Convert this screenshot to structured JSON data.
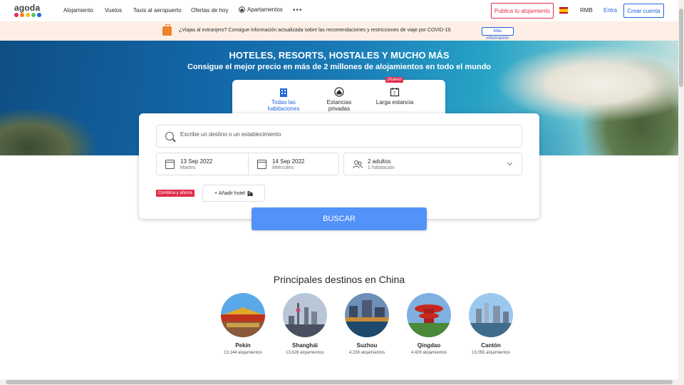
{
  "header": {
    "logo": "agoda",
    "logo_colors": [
      "#e12d4a",
      "#f08228",
      "#f5c11c",
      "#59c36a",
      "#2067da"
    ],
    "nav": [
      "Alojamiento",
      "Vuelos",
      "Taxis al aeropuerto",
      "Ofertas de hoy",
      "Apartamentos"
    ],
    "more_icon": "more-dots-icon",
    "publica_label": "Publica tu alojamiento",
    "flag_icon": "spain-flag-icon",
    "currency": "RMB",
    "signin_label": "Entra",
    "signup_label": "Crear cuenta"
  },
  "banner": {
    "icon": "suitcase-icon",
    "text": "¿Viajas al extranjero? Consigue información actualizada sobre las recomendaciones y restricciones de viaje por COVID-19.",
    "button_label": "Más información"
  },
  "hero": {
    "title": "HOTELES, RESORTS, HOSTALES Y MUCHO MÁS",
    "subtitle": "Consigue el mejor precio en más de 2 millones de alojamientos en todo el mundo"
  },
  "tabs": [
    {
      "label": "Todas las habitaciones",
      "icon": "building-icon",
      "active": true
    },
    {
      "label": "Estancias privadas",
      "icon": "house-icon",
      "active": false
    },
    {
      "label": "Larga estancia",
      "icon": "calendar-7-icon",
      "active": false,
      "badge": "¡Nuevo!"
    }
  ],
  "search": {
    "destination_placeholder": "Escribe un destino o un establecimiento",
    "checkin_date": "13 Sep 2022",
    "checkin_day": "Martes",
    "checkout_date": "14 Sep 2022",
    "checkout_day": "Miércoles",
    "guests": "2 adultos",
    "rooms": "1 habitación",
    "combo_badge": "Combina y ahorra",
    "add_hotel_label": "+ Añadir hotel",
    "search_button": "BUSCAR"
  },
  "destinations": {
    "title": "Principales destinos en China",
    "cities": [
      {
        "name": "Pekín",
        "count": "13,144 alojamientos"
      },
      {
        "name": "Shanghái",
        "count": "13,628 alojamientos"
      },
      {
        "name": "Suzhou",
        "count": "4,238 alojamientos"
      },
      {
        "name": "Qingdao",
        "count": "4,426 alojamientos"
      },
      {
        "name": "Cantón",
        "count": "13,055 alojamientos"
      }
    ]
  },
  "colors": {
    "accent_blue": "#2067da",
    "brand_red": "#e12d4a",
    "search_button": "#5392f9",
    "banner_bg": "#fdefe6"
  }
}
